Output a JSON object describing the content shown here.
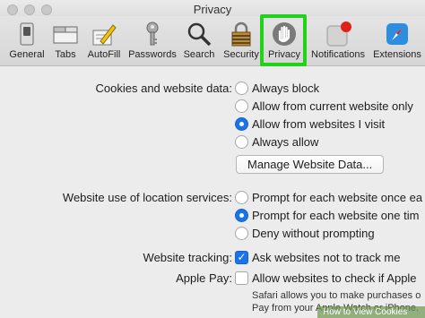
{
  "window": {
    "title": "Privacy"
  },
  "toolbar": {
    "items": [
      {
        "label": "General",
        "icon": "general-switch-icon"
      },
      {
        "label": "Tabs",
        "icon": "tabs-icon"
      },
      {
        "label": "AutoFill",
        "icon": "autofill-pencil-icon"
      },
      {
        "label": "Passwords",
        "icon": "key-icon"
      },
      {
        "label": "Search",
        "icon": "magnifier-icon"
      },
      {
        "label": "Security",
        "icon": "padlock-icon"
      },
      {
        "label": "Privacy",
        "icon": "hand-icon",
        "selected": true
      },
      {
        "label": "Notifications",
        "icon": "notification-badge-icon"
      },
      {
        "label": "Extensions",
        "icon": "compass-puzzle-icon"
      }
    ],
    "highlight_color": "#22d11a"
  },
  "cookies": {
    "label": "Cookies and website data:",
    "options": [
      "Always block",
      "Allow from current website only",
      "Allow from websites I visit",
      "Always allow"
    ],
    "selected": "Allow from websites I visit",
    "manage_button": "Manage Website Data..."
  },
  "location": {
    "label": "Website use of location services:",
    "options": [
      "Prompt for each website once ea",
      "Prompt for each website one tim",
      "Deny without prompting"
    ],
    "selected": "Prompt for each website one tim"
  },
  "tracking": {
    "label": "Website tracking:",
    "checkbox": "Ask websites not to track me",
    "checked": true
  },
  "applepay": {
    "label": "Apple Pay:",
    "checkbox": "Allow websites to check if Apple",
    "checked": false,
    "note_line1": "Safari allows you to make purchases o",
    "note_line2": "Pay from your Apple Watch or iPhone."
  },
  "watermark": {
    "text": "How to View Cookies"
  },
  "colors": {
    "accent": "#1a73e8",
    "background": "#ececec"
  }
}
